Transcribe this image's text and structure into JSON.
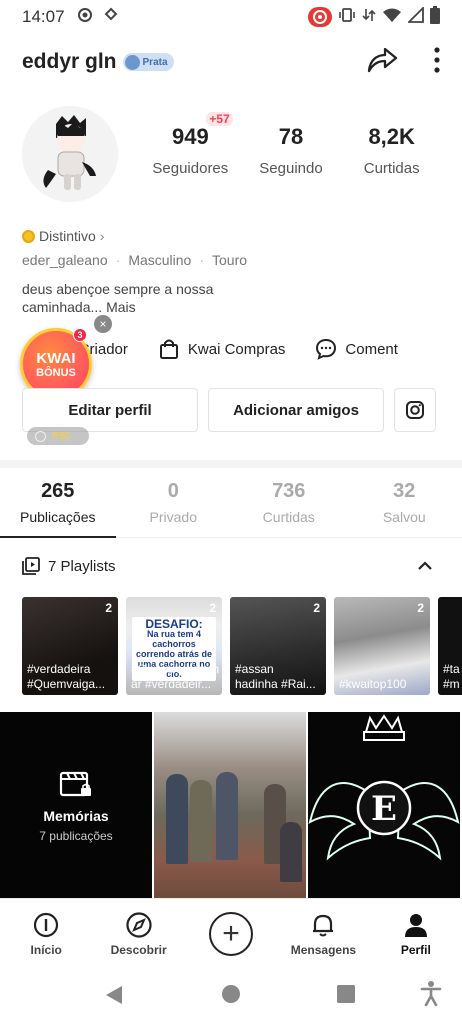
{
  "status_bar": {
    "time": "14:07"
  },
  "header": {
    "username": "eddyr gln",
    "badge_label": "Prata"
  },
  "stats": [
    {
      "value": "949",
      "label": "Seguidores",
      "delta": "+57"
    },
    {
      "value": "78",
      "label": "Seguindo"
    },
    {
      "value": "8,2K",
      "label": "Curtidas"
    }
  ],
  "profile": {
    "distintivo": "Distintivo",
    "handle": "eder_galeano",
    "gender": "Masculino",
    "sign": "Touro",
    "bio_line1": "deus abençoe sempre a nossa",
    "bio_line2": "caminhada...",
    "bio_more": "Mais"
  },
  "links": {
    "creator": "al do Criador",
    "shop": "Kwai Compras",
    "comments": "Coment"
  },
  "kwai_bonus": {
    "line1": "KWAI",
    "line2": "BÔNUS",
    "count": "3",
    "pill": "R$0"
  },
  "buttons": {
    "edit": "Editar perfil",
    "add": "Adicionar amigos"
  },
  "tabs": [
    {
      "value": "265",
      "label": "Publicações",
      "active": true
    },
    {
      "value": "0",
      "label": "Privado"
    },
    {
      "value": "736",
      "label": "Curtidas"
    },
    {
      "value": "32",
      "label": "Salvou"
    }
  ],
  "playlists": {
    "header": "7 Playlists",
    "cards": [
      {
        "count": "2",
        "text": "#verdadeira\n#Quemvaiga..."
      },
      {
        "count": "2",
        "text": "#Quemvaigannh\nar #verdadeir...",
        "overlay_title": "DESAFIO:",
        "overlay_text": "Na rua tem 4 cachorros correndo atrás de uma cachorra no cio."
      },
      {
        "count": "2",
        "text": "#assan\nhadinha #Rai..."
      },
      {
        "count": "2",
        "text": "#kwaitop100"
      },
      {
        "count": "",
        "text": "#ta\n#m"
      }
    ]
  },
  "memories": {
    "title": "Memórias",
    "subtitle": "7 publicações"
  },
  "grid_letter": "E",
  "bottom_nav": [
    {
      "label": "Início"
    },
    {
      "label": "Descobrir"
    },
    {
      "label": ""
    },
    {
      "label": "Mensagens"
    },
    {
      "label": "Perfil",
      "active": true
    }
  ]
}
